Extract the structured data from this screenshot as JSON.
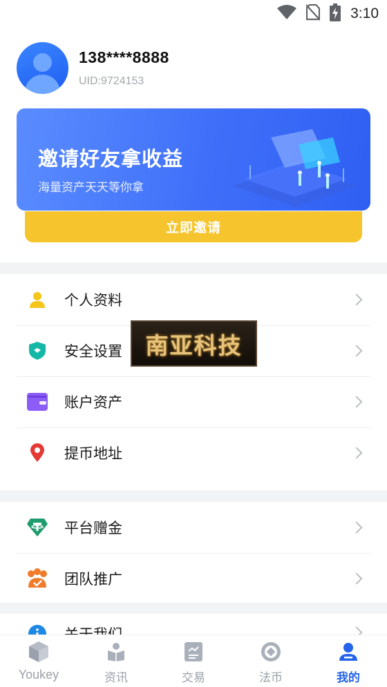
{
  "status_bar": {
    "time": "3:10",
    "icons": [
      "wifi-icon",
      "no-sim-icon",
      "battery-charging-icon"
    ]
  },
  "profile": {
    "phone": "138****8888",
    "uid": "UID:9724153",
    "avatar_icon": "user-avatar-icon"
  },
  "banner": {
    "title": "邀请好友拿收益",
    "subtitle": "海量资产天天等你拿",
    "button_label": "立即邀请",
    "colors": {
      "start": "#5a8cff",
      "end": "#2e5ff2",
      "button": "#f6c42c"
    }
  },
  "menu_group_1": [
    {
      "label": "个人资料",
      "icon": "person-icon",
      "color": "#f5c518"
    },
    {
      "label": "安全设置",
      "icon": "shield-icon",
      "color": "#14b8a6"
    },
    {
      "label": "账户资产",
      "icon": "wallet-icon",
      "color": "#8b5cf6"
    },
    {
      "label": "提币地址",
      "icon": "location-pin-icon",
      "color": "#e53935"
    }
  ],
  "menu_group_2": [
    {
      "label": "平台赠金",
      "icon": "tether-icon",
      "color": "#1f9d6e"
    },
    {
      "label": "团队推广",
      "icon": "team-icon",
      "color": "#f07c2a"
    }
  ],
  "menu_group_3": [
    {
      "label": "关于我们",
      "icon": "info-icon",
      "color": "#1e88e5"
    }
  ],
  "watermark": {
    "text": "南亚科技"
  },
  "bottom_nav": {
    "active": "我的",
    "accent": "#2563eb",
    "items": [
      {
        "label": "Youkey",
        "icon": "cube-icon"
      },
      {
        "label": "资讯",
        "icon": "news-icon"
      },
      {
        "label": "交易",
        "icon": "trade-icon"
      },
      {
        "label": "法币",
        "icon": "fiat-coin-icon"
      },
      {
        "label": "我的",
        "icon": "profile-icon"
      }
    ]
  }
}
